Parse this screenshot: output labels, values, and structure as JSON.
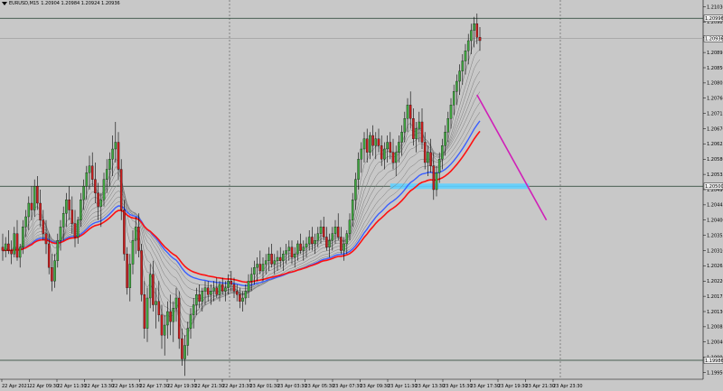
{
  "window": {
    "symbol_timeframe": "EURUSD,M15",
    "ohlc": "1.20904 1.20984 1.20924 1.20936"
  },
  "price_axis": {
    "labels": [
      "1.21030",
      "1.20985",
      "1.20940",
      "1.20895",
      "1.20850",
      "1.20805",
      "1.20760",
      "1.20715",
      "1.20670",
      "1.20625",
      "1.20580",
      "1.20535",
      "1.20490",
      "1.20445",
      "1.20400",
      "1.20355",
      "1.20310",
      "1.20265",
      "1.20220",
      "1.20175",
      "1.20130",
      "1.20085",
      "1.20040",
      "1.19995",
      "1.19950"
    ],
    "badges": [
      {
        "text": "1.20996",
        "price": 1.20996,
        "color": "#f0f0f0"
      },
      {
        "text": "1.20936",
        "price": 1.20936,
        "color": "#f0f0f0"
      },
      {
        "text": "1.20500",
        "price": 1.205,
        "color": "#f0f0f0"
      },
      {
        "text": "1.19986",
        "price": 1.19986,
        "color": "#f0f0f0"
      }
    ]
  },
  "time_axis": {
    "labels": [
      "22 Apr 2021",
      "22 Apr 09:30",
      "22 Apr 11:30",
      "22 Apr 13:30",
      "22 Apr 15:30",
      "22 Apr 17:30",
      "22 Apr 19:30",
      "22 Apr 21:30",
      "22 Apr 23:30",
      "23 Apr 01:30",
      "23 Apr 03:30",
      "23 Apr 05:30",
      "23 Apr 07:30",
      "23 Apr 09:30",
      "23 Apr 11:30",
      "23 Apr 13:30",
      "23 Apr 15:30",
      "23 Apr 17:30",
      "23 Apr 19:30",
      "23 Apr 21:30",
      "23 Apr 23:30"
    ]
  },
  "colors": {
    "background": "#c8c8c8",
    "bull": "#3fa63f",
    "bear": "#c81e1e",
    "wick": "#000000",
    "ma_red": "#ff1010",
    "ma_blue": "#3a5fff",
    "ma_gray": "#7a7a7a",
    "trendline": "#d01fb8",
    "zone": "#5fd0ff",
    "hline": "#1e3b2b"
  },
  "chart_data": {
    "type": "candlestick",
    "symbol": "EURUSD",
    "timeframe": "M15",
    "ylim": [
      1.1993,
      1.2105
    ],
    "horizontal_levels": [
      1.20996,
      1.205,
      1.19986
    ],
    "zone": {
      "price": 1.205,
      "from_index": 134,
      "to_index": 182
    },
    "trendline": {
      "from_index": 164,
      "from_price": 1.2077,
      "to_index": 188,
      "to_price": 1.204
    },
    "ohlc": [
      [
        1.2032,
        1.2036,
        1.2028,
        1.2031
      ],
      [
        1.2031,
        1.2035,
        1.2029,
        1.2033
      ],
      [
        1.2033,
        1.2037,
        1.203,
        1.2031
      ],
      [
        1.2031,
        1.2034,
        1.2027,
        1.203
      ],
      [
        1.203,
        1.2038,
        1.2029,
        1.2036
      ],
      [
        1.2036,
        1.204,
        1.2028,
        1.2029
      ],
      [
        1.2029,
        1.2033,
        1.2026,
        1.2032
      ],
      [
        1.2032,
        1.204,
        1.203,
        1.2038
      ],
      [
        1.2038,
        1.2043,
        1.2035,
        1.2041
      ],
      [
        1.2041,
        1.2047,
        1.2037,
        1.2045
      ],
      [
        1.2045,
        1.205,
        1.204,
        1.2043
      ],
      [
        1.2043,
        1.2052,
        1.2041,
        1.205
      ],
      [
        1.205,
        1.2053,
        1.2043,
        1.2045
      ],
      [
        1.2045,
        1.2049,
        1.2038,
        1.204
      ],
      [
        1.204,
        1.2043,
        1.2034,
        1.2036
      ],
      [
        1.2036,
        1.204,
        1.203,
        1.2033
      ],
      [
        1.2033,
        1.2036,
        1.2024,
        1.2026
      ],
      [
        1.2026,
        1.203,
        1.2019,
        1.2022
      ],
      [
        1.2022,
        1.203,
        1.202,
        1.2028
      ],
      [
        1.2028,
        1.2036,
        1.2026,
        1.2034
      ],
      [
        1.2034,
        1.204,
        1.2031,
        1.2038
      ],
      [
        1.2038,
        1.2044,
        1.2034,
        1.2042
      ],
      [
        1.2042,
        1.2048,
        1.2038,
        1.2046
      ],
      [
        1.2046,
        1.205,
        1.204,
        1.2043
      ],
      [
        1.2043,
        1.2047,
        1.2036,
        1.2039
      ],
      [
        1.2039,
        1.2043,
        1.2032,
        1.2035
      ],
      [
        1.2035,
        1.2041,
        1.2033,
        1.204
      ],
      [
        1.204,
        1.2048,
        1.2038,
        1.2046
      ],
      [
        1.2046,
        1.2052,
        1.2043,
        1.205
      ],
      [
        1.205,
        1.2056,
        1.2046,
        1.2054
      ],
      [
        1.2054,
        1.2059,
        1.2049,
        1.2056
      ],
      [
        1.2056,
        1.206,
        1.205,
        1.2052
      ],
      [
        1.2052,
        1.2057,
        1.2045,
        1.2048
      ],
      [
        1.2048,
        1.2051,
        1.204,
        1.2044
      ],
      [
        1.2044,
        1.2048,
        1.2038,
        1.2046
      ],
      [
        1.2046,
        1.2054,
        1.2044,
        1.2052
      ],
      [
        1.2052,
        1.2058,
        1.2048,
        1.2055
      ],
      [
        1.2055,
        1.206,
        1.205,
        1.2058
      ],
      [
        1.2058,
        1.2065,
        1.2053,
        1.2061
      ],
      [
        1.2061,
        1.2069,
        1.2057,
        1.2063
      ],
      [
        1.2063,
        1.2066,
        1.2052,
        1.2055
      ],
      [
        1.2055,
        1.2058,
        1.204,
        1.2043
      ],
      [
        1.2043,
        1.2046,
        1.2028,
        1.203
      ],
      [
        1.203,
        1.2032,
        1.2018,
        1.202
      ],
      [
        1.202,
        1.203,
        1.2016,
        1.2027
      ],
      [
        1.2027,
        1.2037,
        1.2024,
        1.2034
      ],
      [
        1.2034,
        1.2041,
        1.203,
        1.2038
      ],
      [
        1.2038,
        1.2042,
        1.2029,
        1.2031
      ],
      [
        1.2031,
        1.2033,
        1.2016,
        1.2018
      ],
      [
        1.2018,
        1.2022,
        1.2005,
        1.2008
      ],
      [
        1.2008,
        1.202,
        1.2004,
        1.2017
      ],
      [
        1.2017,
        1.2027,
        1.2014,
        1.2024
      ],
      [
        1.2024,
        1.2028,
        1.2013,
        1.2015
      ],
      [
        1.2015,
        1.202,
        1.2008,
        1.2016
      ],
      [
        1.2016,
        1.2022,
        1.201,
        1.2012
      ],
      [
        1.2012,
        1.2015,
        1.2002,
        1.2006
      ],
      [
        1.2006,
        1.2012,
        1.2,
        1.2009
      ],
      [
        1.2009,
        1.2016,
        1.2005,
        1.2013
      ],
      [
        1.2013,
        1.2018,
        1.2006,
        1.201
      ],
      [
        1.201,
        1.2016,
        1.2004,
        1.2014
      ],
      [
        1.2014,
        1.202,
        1.201,
        1.2017
      ],
      [
        1.2017,
        1.2019,
        1.2002,
        1.2005
      ],
      [
        1.2005,
        1.2008,
        1.1997,
        1.1999
      ],
      [
        1.1999,
        1.2006,
        1.1994,
        1.2003
      ],
      [
        1.2003,
        1.201,
        1.2,
        1.2008
      ],
      [
        1.2008,
        1.2014,
        1.2005,
        1.2012
      ],
      [
        1.2012,
        1.2017,
        1.2008,
        1.2015
      ],
      [
        1.2015,
        1.202,
        1.2012,
        1.2018
      ],
      [
        1.2018,
        1.2021,
        1.2014,
        1.2016
      ],
      [
        1.2016,
        1.202,
        1.2013,
        1.2019
      ],
      [
        1.2019,
        1.2022,
        1.2015,
        1.202
      ],
      [
        1.202,
        1.2022,
        1.2016,
        1.2018
      ],
      [
        1.2018,
        1.2021,
        1.2015,
        1.2019
      ],
      [
        1.2019,
        1.2022,
        1.2016,
        1.202
      ],
      [
        1.202,
        1.2023,
        1.2017,
        1.2018
      ],
      [
        1.2018,
        1.2022,
        1.2016,
        1.2021
      ],
      [
        1.2021,
        1.2023,
        1.2018,
        1.2019
      ],
      [
        1.2019,
        1.2022,
        1.2016,
        1.202
      ],
      [
        1.202,
        1.2024,
        1.2018,
        1.2022
      ],
      [
        1.2022,
        1.2025,
        1.2019,
        1.2021
      ],
      [
        1.2021,
        1.2023,
        1.2017,
        1.2019
      ],
      [
        1.2019,
        1.2021,
        1.2016,
        1.2018
      ],
      [
        1.2018,
        1.202,
        1.2014,
        1.2016
      ],
      [
        1.2016,
        1.2019,
        1.2013,
        1.2017
      ],
      [
        1.2017,
        1.2021,
        1.2015,
        1.2019
      ],
      [
        1.2019,
        1.2024,
        1.2017,
        1.2022
      ],
      [
        1.2022,
        1.2026,
        1.2019,
        1.2024
      ],
      [
        1.2024,
        1.2028,
        1.2021,
        1.2026
      ],
      [
        1.2026,
        1.2029,
        1.2022,
        1.2027
      ],
      [
        1.2027,
        1.2031,
        1.2024,
        1.2025
      ],
      [
        1.2025,
        1.2029,
        1.2022,
        1.2027
      ],
      [
        1.2027,
        1.203,
        1.2024,
        1.2028
      ],
      [
        1.2028,
        1.2032,
        1.2025,
        1.203
      ],
      [
        1.203,
        1.2033,
        1.2026,
        1.2027
      ],
      [
        1.2027,
        1.203,
        1.2024,
        1.2028
      ],
      [
        1.2028,
        1.2031,
        1.2025,
        1.2029
      ],
      [
        1.2029,
        1.2032,
        1.2026,
        1.2028
      ],
      [
        1.2028,
        1.2031,
        1.2025,
        1.203
      ],
      [
        1.203,
        1.2033,
        1.2027,
        1.2031
      ],
      [
        1.2031,
        1.2034,
        1.2028,
        1.2032
      ],
      [
        1.2032,
        1.2034,
        1.2027,
        1.2029
      ],
      [
        1.2029,
        1.2032,
        1.2026,
        1.203
      ],
      [
        1.203,
        1.2034,
        1.2028,
        1.2033
      ],
      [
        1.2033,
        1.2036,
        1.203,
        1.2031
      ],
      [
        1.2031,
        1.2034,
        1.2028,
        1.2032
      ],
      [
        1.2032,
        1.2035,
        1.2029,
        1.2033
      ],
      [
        1.2033,
        1.2037,
        1.2031,
        1.2035
      ],
      [
        1.2035,
        1.2038,
        1.2031,
        1.2033
      ],
      [
        1.2033,
        1.2036,
        1.203,
        1.2034
      ],
      [
        1.2034,
        1.2038,
        1.2032,
        1.2036
      ],
      [
        1.2036,
        1.204,
        1.2033,
        1.2038
      ],
      [
        1.2038,
        1.2041,
        1.2034,
        1.2035
      ],
      [
        1.2035,
        1.2038,
        1.2031,
        1.2032
      ],
      [
        1.2032,
        1.2036,
        1.2029,
        1.2034
      ],
      [
        1.2034,
        1.2038,
        1.2031,
        1.2036
      ],
      [
        1.2036,
        1.204,
        1.2033,
        1.2038
      ],
      [
        1.2038,
        1.2042,
        1.2034,
        1.2035
      ],
      [
        1.2035,
        1.2038,
        1.203,
        1.2031
      ],
      [
        1.2031,
        1.2035,
        1.2028,
        1.2033
      ],
      [
        1.2033,
        1.2037,
        1.203,
        1.2036
      ],
      [
        1.2036,
        1.2042,
        1.2034,
        1.204
      ],
      [
        1.204,
        1.2048,
        1.2038,
        1.2046
      ],
      [
        1.2046,
        1.2054,
        1.2043,
        1.2052
      ],
      [
        1.2052,
        1.206,
        1.2049,
        1.2058
      ],
      [
        1.2058,
        1.2063,
        1.2054,
        1.2061
      ],
      [
        1.2061,
        1.2066,
        1.2057,
        1.2064
      ],
      [
        1.2064,
        1.2067,
        1.2057,
        1.206
      ],
      [
        1.206,
        1.2066,
        1.2058,
        1.2065
      ],
      [
        1.2065,
        1.2068,
        1.2059,
        1.2062
      ],
      [
        1.2062,
        1.2066,
        1.2058,
        1.2064
      ],
      [
        1.2064,
        1.2067,
        1.206,
        1.2062
      ],
      [
        1.2062,
        1.2065,
        1.2056,
        1.2058
      ],
      [
        1.2058,
        1.2063,
        1.2055,
        1.2061
      ],
      [
        1.2061,
        1.2065,
        1.2057,
        1.2063
      ],
      [
        1.2063,
        1.2066,
        1.2058,
        1.206
      ],
      [
        1.206,
        1.2064,
        1.2055,
        1.2057
      ],
      [
        1.2057,
        1.2062,
        1.2053,
        1.206
      ],
      [
        1.206,
        1.2065,
        1.2057,
        1.2063
      ],
      [
        1.2063,
        1.2068,
        1.2059,
        1.2066
      ],
      [
        1.2066,
        1.2072,
        1.2063,
        1.207
      ],
      [
        1.207,
        1.2076,
        1.2066,
        1.2074
      ],
      [
        1.2074,
        1.2078,
        1.2067,
        1.207
      ],
      [
        1.207,
        1.2073,
        1.2062,
        1.2064
      ],
      [
        1.2064,
        1.2069,
        1.206,
        1.2067
      ],
      [
        1.2067,
        1.2072,
        1.2063,
        1.2069
      ],
      [
        1.2069,
        1.2073,
        1.2061,
        1.2063
      ],
      [
        1.2063,
        1.2066,
        1.2055,
        1.2057
      ],
      [
        1.2057,
        1.2062,
        1.2053,
        1.206
      ],
      [
        1.206,
        1.2064,
        1.2054,
        1.2056
      ],
      [
        1.2056,
        1.206,
        1.2046,
        1.2049
      ],
      [
        1.2049,
        1.2056,
        1.2047,
        1.2054
      ],
      [
        1.2054,
        1.206,
        1.2051,
        1.2058
      ],
      [
        1.2058,
        1.2064,
        1.2055,
        1.2062
      ],
      [
        1.2062,
        1.2068,
        1.2059,
        1.2066
      ],
      [
        1.2066,
        1.2072,
        1.2063,
        1.207
      ],
      [
        1.207,
        1.2076,
        1.2067,
        1.2074
      ],
      [
        1.2074,
        1.208,
        1.2071,
        1.2078
      ],
      [
        1.2078,
        1.2083,
        1.2074,
        1.2081
      ],
      [
        1.2081,
        1.2086,
        1.2077,
        1.2084
      ],
      [
        1.2084,
        1.2089,
        1.208,
        1.2087
      ],
      [
        1.2087,
        1.2092,
        1.2083,
        1.209
      ],
      [
        1.209,
        1.2095,
        1.2086,
        1.2093
      ],
      [
        1.2093,
        1.2098,
        1.2089,
        1.2096
      ],
      [
        1.2096,
        1.21,
        1.2091,
        1.2098
      ],
      [
        1.2098,
        1.2101,
        1.2092,
        1.2094
      ],
      [
        1.2094,
        1.2097,
        1.209,
        1.2093
      ]
    ]
  }
}
